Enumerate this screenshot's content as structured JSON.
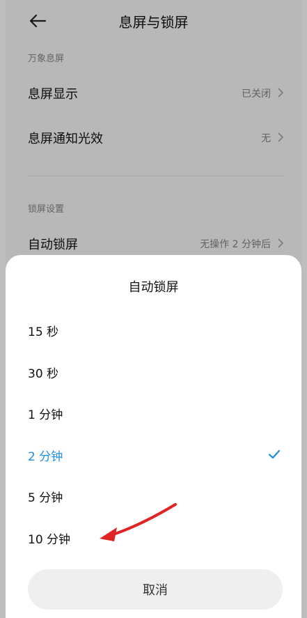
{
  "header": {
    "title": "息屏与锁屏",
    "back_icon": "back-arrow-icon"
  },
  "sections": [
    {
      "label": "万象息屏",
      "items": [
        {
          "label": "息屏显示",
          "value": "已关闭"
        },
        {
          "label": "息屏通知光效",
          "value": "无"
        }
      ]
    },
    {
      "label": "锁屏设置",
      "items": [
        {
          "label": "自动锁屏",
          "value": "无操作 2 分钟后"
        }
      ]
    }
  ],
  "sheet": {
    "title": "自动锁屏",
    "options": [
      {
        "label": "15 秒",
        "selected": false
      },
      {
        "label": "30 秒",
        "selected": false
      },
      {
        "label": "1 分钟",
        "selected": false
      },
      {
        "label": "2 分钟",
        "selected": true
      },
      {
        "label": "5 分钟",
        "selected": false
      },
      {
        "label": "10 分钟",
        "selected": false
      }
    ],
    "cancel_label": "取消"
  },
  "colors": {
    "accent": "#1f8fe0",
    "annotation_arrow": "#e02424"
  }
}
